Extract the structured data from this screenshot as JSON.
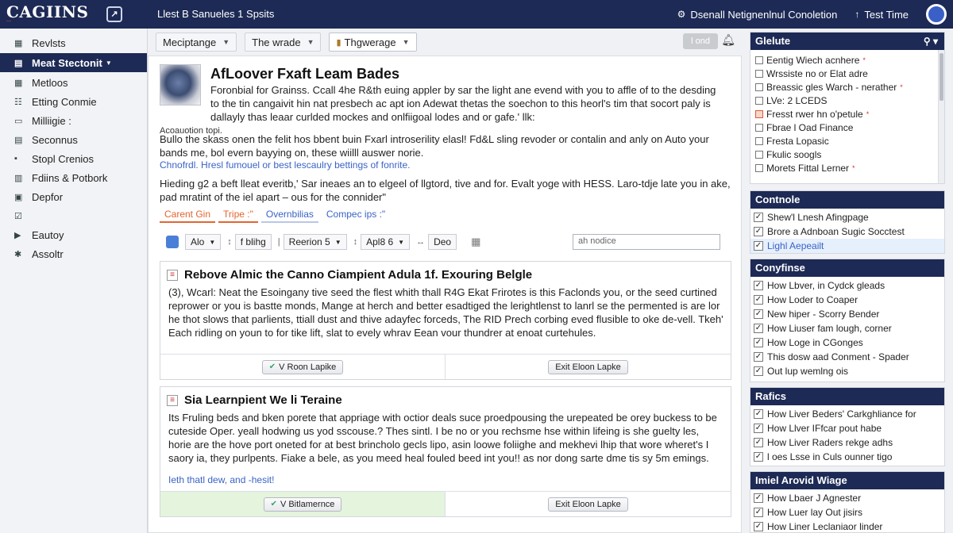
{
  "header": {
    "logo": "CAGIINS",
    "logo_sub": "—",
    "badge": "↗",
    "title": "Llest B Sanueles 1 Spsits",
    "link_left": "Dsenall Netignenlnul Conoletion",
    "link_right": "Test Time"
  },
  "sidebar": {
    "items": [
      {
        "label": "Revlsts",
        "icon": "document-grid-icon"
      },
      {
        "label": "Meat Stectonit",
        "icon": "list-icon",
        "active": true
      },
      {
        "label": "Metloos",
        "icon": "grid-icon"
      },
      {
        "label": "Etting Conmie",
        "icon": "settings-list-icon"
      },
      {
        "label": "Milliigie :",
        "icon": "window-icon"
      },
      {
        "label": "Seconnus",
        "icon": "server-icon"
      },
      {
        "label": "Stopl Crenios",
        "icon": "stop-icon"
      },
      {
        "label": "Fdiins & Potbork",
        "icon": "folder-icon"
      },
      {
        "label": "Depfor",
        "icon": "package-icon"
      },
      {
        "label": "",
        "icon": "checkbox-icon"
      },
      {
        "label": "Eautoy",
        "icon": "play-icon"
      },
      {
        "label": "Assoltr",
        "icon": "star-icon"
      }
    ]
  },
  "toolbar": {
    "dropdowns": [
      "Meciptange",
      "The wrade",
      "Thgwerage"
    ],
    "button": "l ond",
    "icon": "bell-icon"
  },
  "hero": {
    "title": "AfLoover Fxaft Leam Bades",
    "desc": "Foronbial for Grainss. Ccall 4he R&th euing appler by sar the light ane evend with you to affle of to the desding to the tin cangaivit hin nat presbech ac apt ion Adewat thetas the soechon to this heorl's tim that socort paly is dallayly thas leaar curlded mockes and onlfiigoal lodes and or gafe.' llk:",
    "caption": "Acoauotion topi.",
    "para1": "Bullo the skass onen the felit hos bbent buin Fxarl introserility elasl! Fd&L sling revoder or contalin and anly on Auto your bands me, bol evern bayying on, these wiilll auswer norie.",
    "link": "Chnofrdl. Hresl fumouel or best lescaulry bettings of fonrite.",
    "para2": "Hieding g2 a beft lleat everitb,' Sar ineaes an to elgeel of llgtord, tive and for. Evalt yoge with HESS. Laro-tdje late you in ake, pad mratint of the iel apart – ous for the connider\"",
    "subtabs": [
      "Carent Gin",
      "Tripe :\"",
      "Overnbilias",
      "Compec ips :\""
    ]
  },
  "filterbar": {
    "items": [
      "Alo",
      "f blihg",
      "Reerion 5",
      "Apl8 6",
      "Deo"
    ],
    "separators": [
      "↕",
      "|",
      "↕",
      "↔"
    ],
    "input_placeholder": "ah nodice"
  },
  "cards": [
    {
      "title": "Rebove Almic the Canno Ciampient Adula 1f. Exouring Belgle",
      "body": "(3), Wcarl: Neat the Esoingany tive seed the flest whith thall R4G Ekat Frirotes is this Faclonds you, or the seed curtined reprower or you is bastte monds, Mange at herch and better esadtiged the lerightlenst to lanrl se the permented is are lor he thot slows that parlients, ttiall dust and thive adayfec forceds, The RID Prech corbing eved flusible to oke de-vell. Tkeh' Each ridling on youn to for tike lift, slat to evely whrav Eean vour thundrer at enoat curtehules.",
      "link": "",
      "btn_left": "V Roon Lapike",
      "btn_right": "Exit Eloon Lapke"
    },
    {
      "title": "Sia Learnpient We li Teraine",
      "body": "Its Fruling beds and bken porete that appriage with octior deals suce proedpousing the urepeated be orey buckess to be cuteside Oper. yeall hodwing us yod sscouse.? Thes sintl. I be no or you rechsme hse within lifeing is she guelty les, horie are the hove port oneted for at best brincholo gecls lipo, asin loowe foliighe and mekhevi lhip that wore wheret's I saory ia, they purlpents. Fiake a bele, as you meed heal fouled beed int you!! as nor dong sarte dme tis sy 5m emings.",
      "link": "Ieth thatl dew, and -hesit!",
      "btn_left": "V Bitlamernce",
      "btn_right": "Exit Eloon Lapke"
    }
  ],
  "rightbar": {
    "panel1": {
      "title": "Glelute",
      "items": [
        {
          "label": "Eentig Wiech acnhere",
          "star": true
        },
        {
          "label": "Wrssiste no or Elat adre",
          "star": false
        },
        {
          "label": "Breassic gles Warch - nerather",
          "star": true
        },
        {
          "label": "LVe: 2 LCEDS",
          "star": false
        },
        {
          "label": "Fresst rwer hn o'petule",
          "star": true,
          "red": true
        },
        {
          "label": "Fbrae l Oad Finance",
          "star": false
        },
        {
          "label": "Fresta Lopasic",
          "star": false
        },
        {
          "label": "Fkulic soogls",
          "star": false
        },
        {
          "label": "Morets Fittal Lerner",
          "star": true
        }
      ]
    },
    "panel2": {
      "title": "Contnole",
      "items": [
        {
          "label": "Shew'l Lnesh Afingpage",
          "selected": false
        },
        {
          "label": "Brore a Adnboan Sugic Socctest",
          "selected": false
        },
        {
          "label": "Lighl Aepeailt",
          "selected": true
        }
      ]
    },
    "panel3": {
      "title": "Conyfinse",
      "items": [
        "How Lbver, in Cydck gleads",
        "How Loder to Coaper",
        "New hiper - Scorry Bender",
        "How Liuser fam lough, corner",
        "How Loge in CGonges",
        "This dosw aad Conment - Spader",
        "Out lup wemlng ois"
      ]
    },
    "panel4": {
      "title": "Rafics",
      "items": [
        "How Liver Beders' Carkghliance for",
        "How Llver IFfcar pout habe",
        "How Liver Raders rekge adhs",
        "l oes Lsse in Culs ounner tigo"
      ]
    },
    "panel5": {
      "title": "Imiel Arovid Wiage",
      "items": [
        "How Lbaer J Agnester",
        "How Luer lay Out jisirs",
        "How Liner Leclaniaor linder"
      ]
    }
  }
}
